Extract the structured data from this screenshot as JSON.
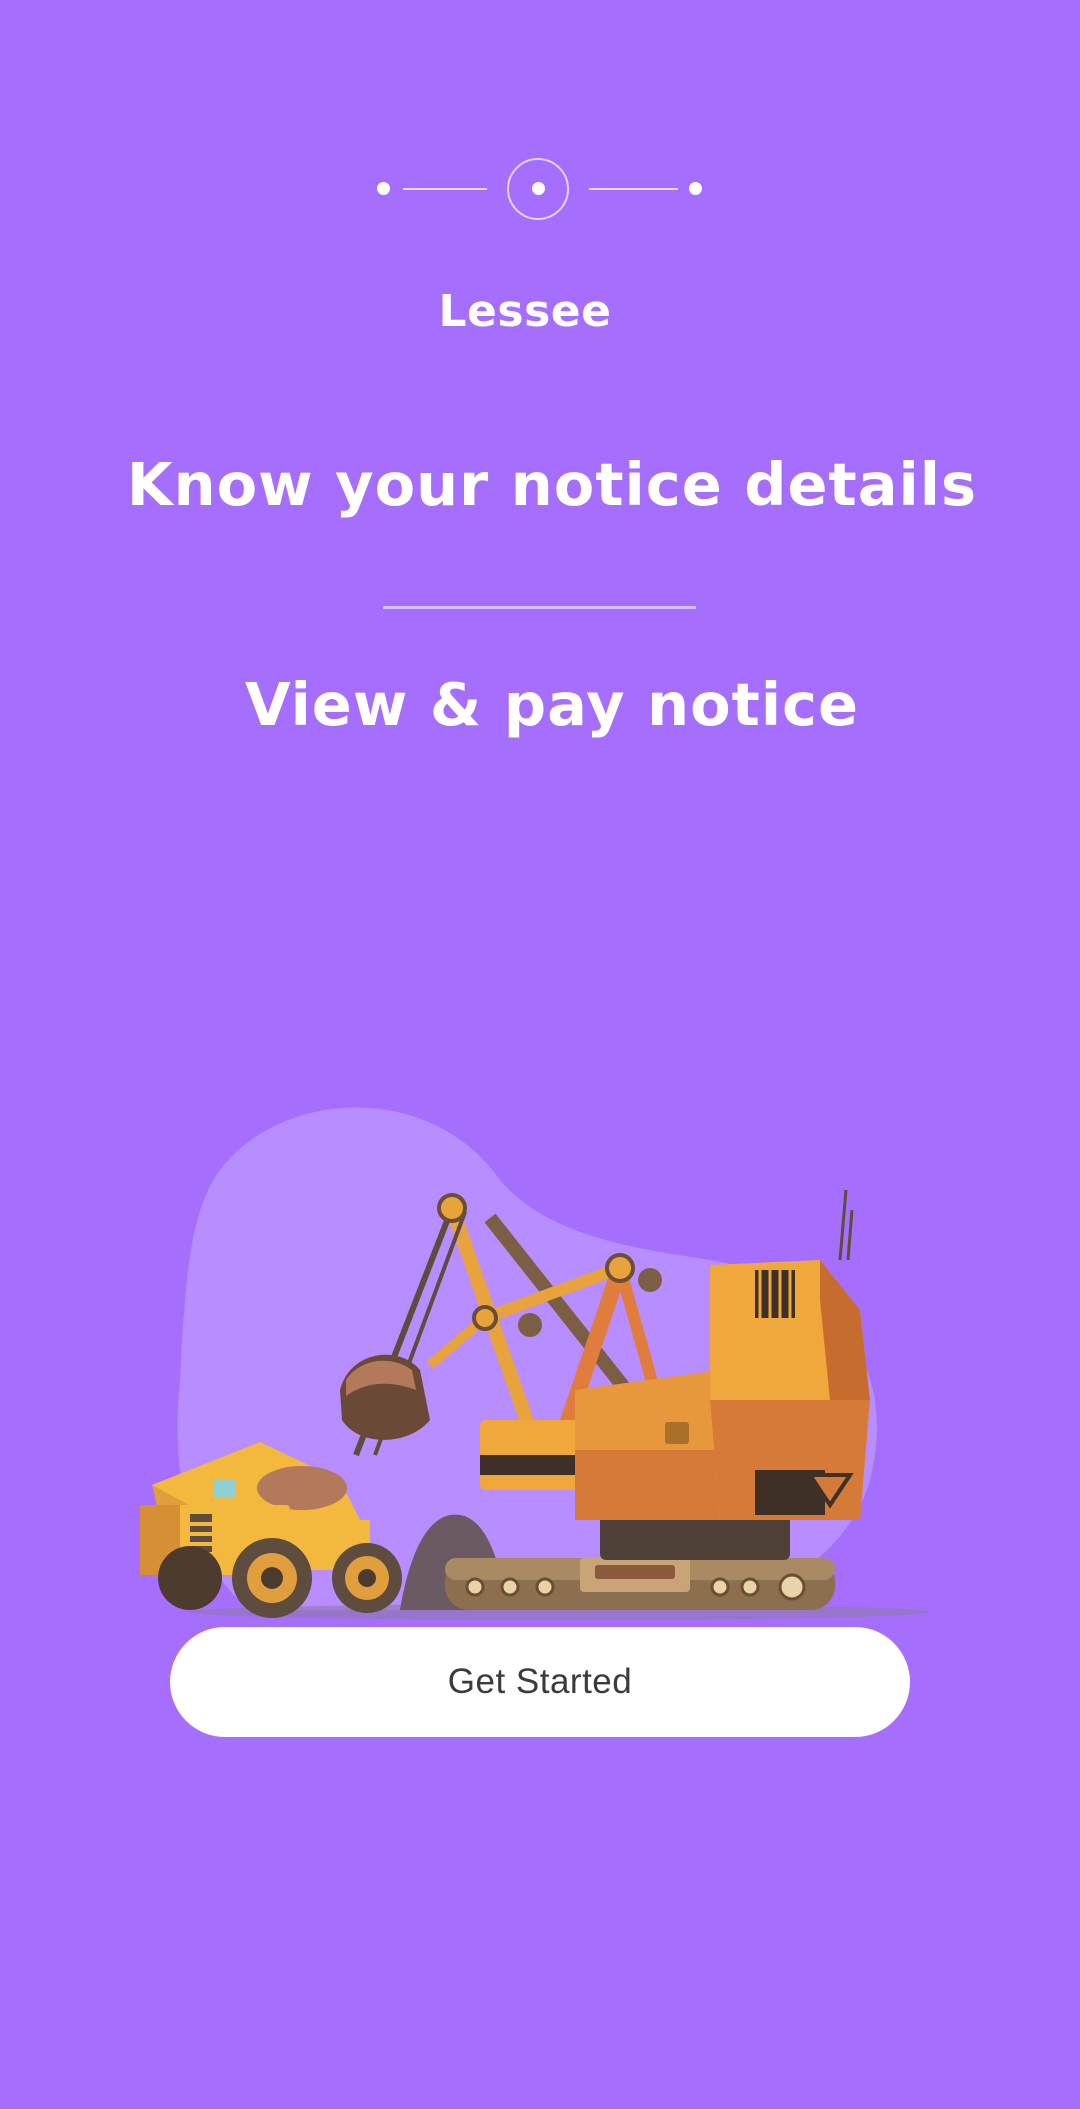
{
  "theme": {
    "background": "#A56EFD",
    "blob": "#B88DFF",
    "button_bg": "#FFFFFF",
    "button_text": "#3B3B3B"
  },
  "stepper": {
    "total_steps": 3,
    "current_step": 2
  },
  "header": {
    "role_label": "Lessee"
  },
  "content": {
    "headline": "Know your notice details",
    "subheadline": "View & pay notice"
  },
  "illustration": {
    "icon": "mining-excavator-and-dump-truck-illustration"
  },
  "actions": {
    "get_started_label": "Get Started"
  }
}
